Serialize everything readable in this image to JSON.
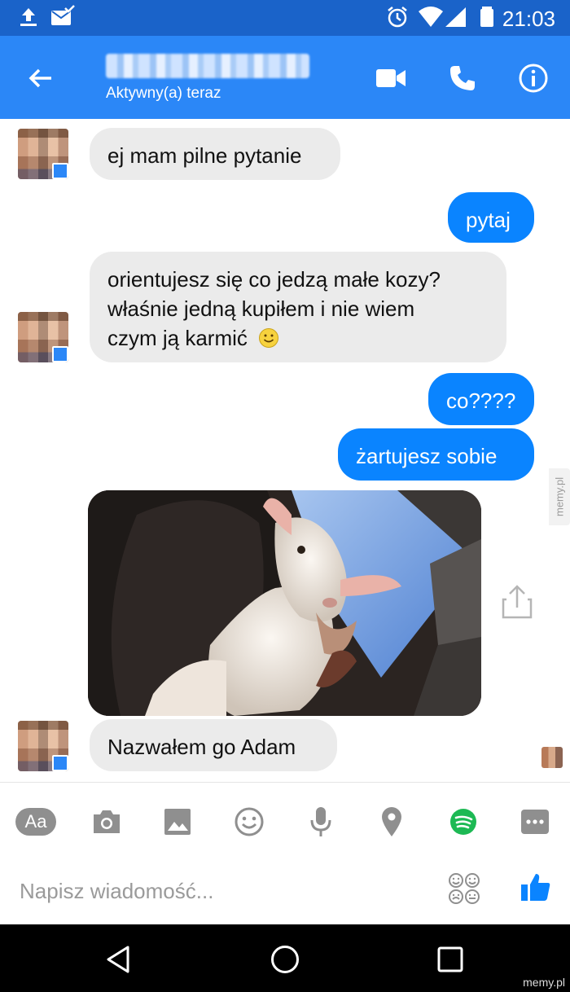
{
  "status_bar": {
    "time": "21:03"
  },
  "header": {
    "status": "Aktywny(a) teraz"
  },
  "messages": {
    "m1": "ej mam pilne pytanie",
    "m2": "pytaj",
    "m3_line1": "orientujesz się co jedzą małe kozy?",
    "m3_line2": "właśnie jedną kupiłem i nie wiem",
    "m3_line3": "czym ją karmić",
    "m4": "co????",
    "m5": "żartujesz sobie",
    "m6": "Nazwałem go Adam"
  },
  "composer": {
    "placeholder": "Napisz wiadomość...",
    "text_format_label": "Aa"
  },
  "watermarks": {
    "side": "memy.pl",
    "bottom": "memy.pl"
  },
  "colors": {
    "status_bar": "#1a63c9",
    "header": "#2b87f7",
    "outgoing_bubble": "#0a84ff",
    "incoming_bubble": "#ebebeb",
    "spotify_green": "#1db954"
  }
}
